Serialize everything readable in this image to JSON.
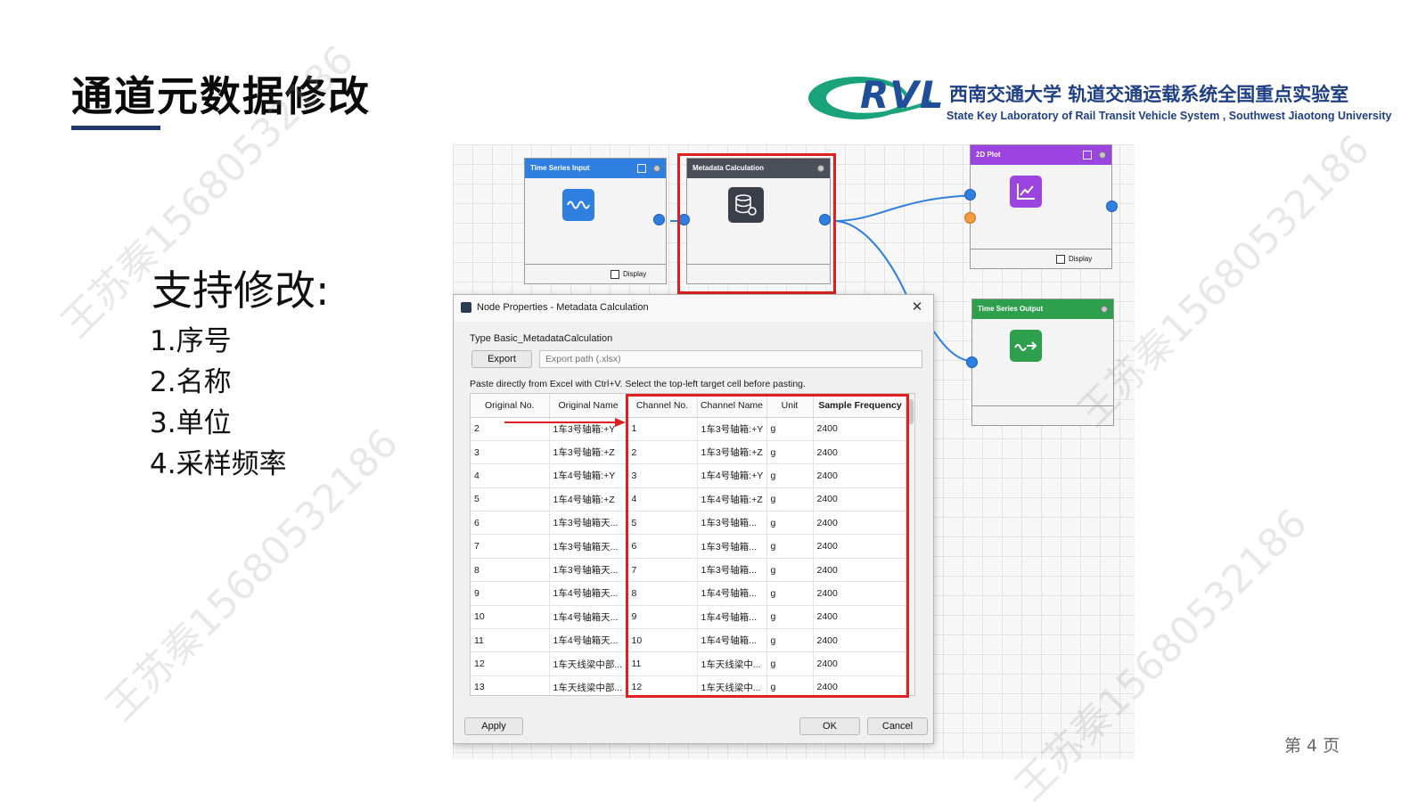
{
  "slide": {
    "title": "通道元数据修改",
    "support_heading": "支持修改:",
    "features": [
      "1.序号",
      "2.名称",
      "3.单位",
      "4.采样频率"
    ],
    "page_number": "第 4 页"
  },
  "logo": {
    "abbr": "RVL",
    "name_cn": "西南交通大学 轨道交通运载系统全国重点实验室",
    "name_en": "State Key Laboratory of Rail Transit Vehicle System , Southwest Jiaotong University"
  },
  "watermark_text": "王苏秦15680532186",
  "nodes": {
    "time_series_input": {
      "title": "Time Series Input",
      "display_label": "Display",
      "color": "#2f7fe0"
    },
    "metadata_calculation": {
      "title": "Metadata Calculation",
      "color": "#4a4f5a"
    },
    "plot_2d": {
      "title": "2D Plot",
      "display_label": "Display",
      "color": "#9b44e0"
    },
    "time_series_output": {
      "title": "Time Series Output",
      "color": "#2ea04d"
    }
  },
  "dialog": {
    "title": "Node Properties - Metadata Calculation",
    "type_line": "Type  Basic_MetadataCalculation",
    "export_button": "Export",
    "export_placeholder": "Export path (.xlsx)",
    "paste_hint": "Paste directly from Excel with Ctrl+V. Select the top-left target cell before pasting.",
    "apply_button": "Apply",
    "ok_button": "OK",
    "cancel_button": "Cancel",
    "close_glyph": "✕"
  },
  "table": {
    "headers": [
      "Original No.",
      "Original Name",
      "Channel No.",
      "Channel Name",
      "Unit",
      "Sample Frequency"
    ],
    "rows": [
      [
        "2",
        "1车3号轴箱:+Y",
        "1",
        "1车3号轴箱:+Y",
        "g",
        "2400"
      ],
      [
        "3",
        "1车3号轴箱:+Z",
        "2",
        "1车3号轴箱:+Z",
        "g",
        "2400"
      ],
      [
        "4",
        "1车4号轴箱:+Y",
        "3",
        "1车4号轴箱:+Y",
        "g",
        "2400"
      ],
      [
        "5",
        "1车4号轴箱:+Z",
        "4",
        "1车4号轴箱:+Z",
        "g",
        "2400"
      ],
      [
        "6",
        "1车3号轴箱天...",
        "5",
        "1车3号轴箱...",
        "g",
        "2400"
      ],
      [
        "7",
        "1车3号轴箱天...",
        "6",
        "1车3号轴箱...",
        "g",
        "2400"
      ],
      [
        "8",
        "1车3号轴箱天...",
        "7",
        "1车3号轴箱...",
        "g",
        "2400"
      ],
      [
        "9",
        "1车4号轴箱天...",
        "8",
        "1车4号轴箱...",
        "g",
        "2400"
      ],
      [
        "10",
        "1车4号轴箱天...",
        "9",
        "1车4号轴箱...",
        "g",
        "2400"
      ],
      [
        "11",
        "1车4号轴箱天...",
        "10",
        "1车4号轴箱...",
        "g",
        "2400"
      ],
      [
        "12",
        "1车天线梁中部...",
        "11",
        "1车天线梁中...",
        "g",
        "2400"
      ],
      [
        "13",
        "1车天线梁中部...",
        "12",
        "1车天线梁中...",
        "g",
        "2400"
      ]
    ]
  },
  "colors": {
    "accent_red": "#e02020",
    "title_underline": "#1f3a6b",
    "logo_blue": "#1f4e9a",
    "logo_green": "#1aa37a"
  }
}
